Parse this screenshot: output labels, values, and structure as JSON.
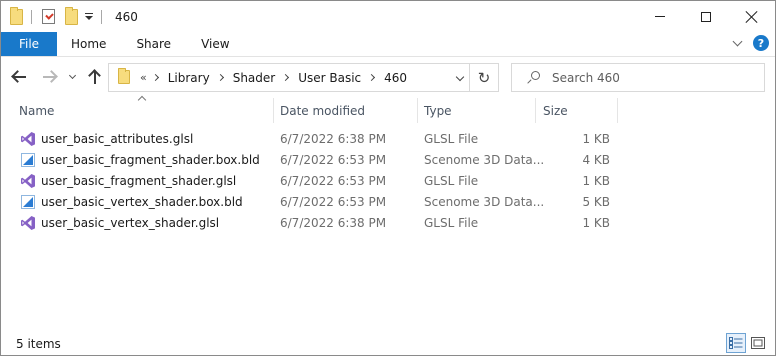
{
  "title": "460",
  "ribbon": {
    "tabs": [
      "File",
      "Home",
      "Share",
      "View"
    ],
    "help_label": "?"
  },
  "address": {
    "lead": "«",
    "crumbs": [
      "Library",
      "Shader",
      "User Basic",
      "460"
    ]
  },
  "search": {
    "placeholder": "Search 460"
  },
  "columns": {
    "name": "Name",
    "date": "Date modified",
    "type": "Type",
    "size": "Size"
  },
  "files": [
    {
      "name": "user_basic_attributes.glsl",
      "date": "6/7/2022 6:38 PM",
      "type": "GLSL File",
      "size": "1 KB",
      "icon": "visual-studio-icon"
    },
    {
      "name": "user_basic_fragment_shader.box.bld",
      "date": "6/7/2022 6:53 PM",
      "type": "Scenome 3D Data...",
      "size": "4 KB",
      "icon": "scenome-data-icon"
    },
    {
      "name": "user_basic_fragment_shader.glsl",
      "date": "6/7/2022 6:53 PM",
      "type": "GLSL File",
      "size": "1 KB",
      "icon": "visual-studio-icon"
    },
    {
      "name": "user_basic_vertex_shader.box.bld",
      "date": "6/7/2022 6:53 PM",
      "type": "Scenome 3D Data...",
      "size": "5 KB",
      "icon": "scenome-data-icon"
    },
    {
      "name": "user_basic_vertex_shader.glsl",
      "date": "6/7/2022 6:38 PM",
      "type": "GLSL File",
      "size": "1 KB",
      "icon": "visual-studio-icon"
    }
  ],
  "status": {
    "count": "5 items"
  },
  "colors": {
    "file_tab": "#1979ca",
    "vs_purple": "#8661c5",
    "scenome_blue": "#2b7cd3"
  }
}
